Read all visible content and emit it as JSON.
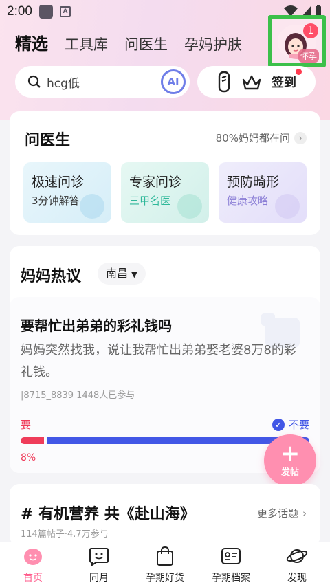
{
  "status": {
    "time": "2:00"
  },
  "header": {
    "tabs": [
      {
        "label": "精选",
        "active": true
      },
      {
        "label": "工具库"
      },
      {
        "label": "问医生"
      },
      {
        "label": "孕妈护肤"
      }
    ],
    "avatar": {
      "badge": "1",
      "tag": "怀孕"
    }
  },
  "search": {
    "text": "hcg低",
    "ai_label": "AI"
  },
  "tools": {
    "signin_label": "签到"
  },
  "doctor": {
    "title": "问医生",
    "more": "80%妈妈都在问",
    "tiles": [
      {
        "title": "极速问诊",
        "sub": "3分钟解答",
        "color": "#333"
      },
      {
        "title": "专家问诊",
        "sub": "三甲名医",
        "color": "#2fb89a"
      },
      {
        "title": "预防畸形",
        "sub": "健康攻略",
        "color": "#8b7ed6"
      }
    ]
  },
  "hot": {
    "title": "妈妈热议",
    "city": "南昌",
    "topic": {
      "title": "要帮忙出弟弟的彩礼钱吗",
      "body": "妈妈突然找我，说让我帮忙出弟弟娶老婆8万8的彩礼钱。",
      "meta": "|8715_8839   1448人已参与",
      "yes_label": "要",
      "no_label": "不要",
      "yes_pct_label": "8%",
      "yes_fraction": 0.08
    }
  },
  "fab": {
    "label": "发帖"
  },
  "hashtag": {
    "title": "# 有机营养 共《赴山海》",
    "more": "更多话题",
    "meta": "114篇帖子·4.7万参与"
  },
  "nav": {
    "items": [
      {
        "label": "首页",
        "active": true
      },
      {
        "label": "同月"
      },
      {
        "label": "孕期好货"
      },
      {
        "label": "孕期档案"
      },
      {
        "label": "发现"
      }
    ]
  },
  "colors": {
    "accent": "#ff5c8c",
    "vote_yes": "#ef3c5a",
    "vote_no": "#4257e6",
    "highlight_box": "#3cc04a"
  }
}
